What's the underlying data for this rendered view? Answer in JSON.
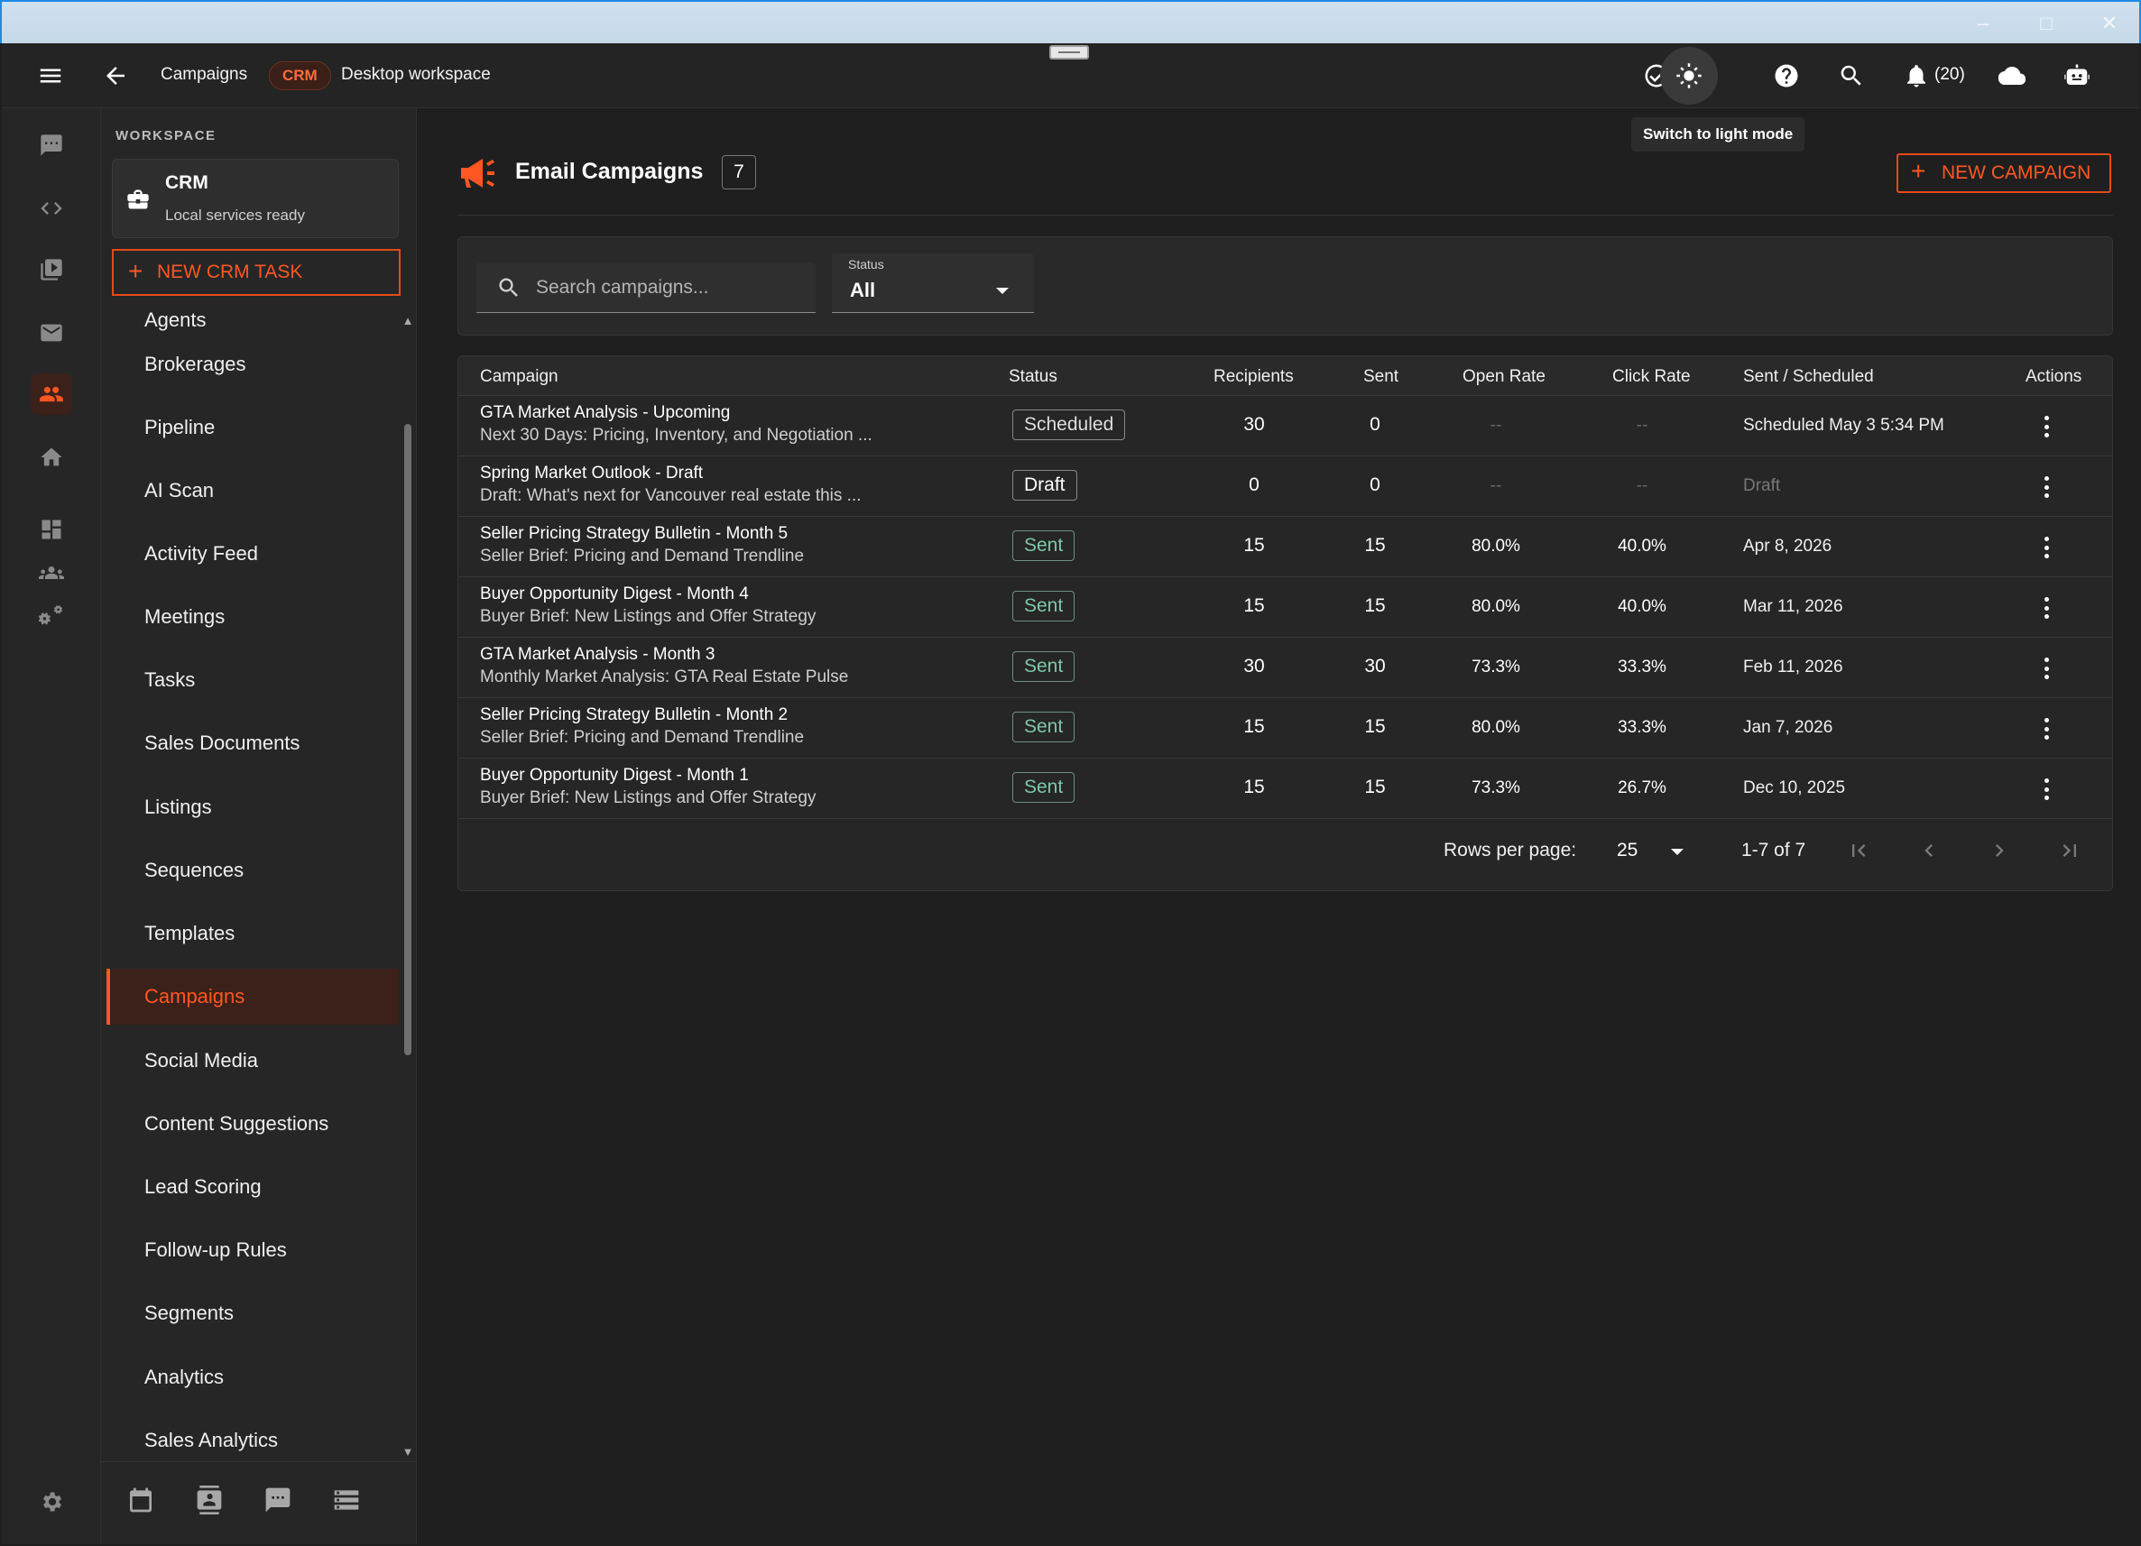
{
  "header": {
    "section_title": "Campaigns",
    "crm_badge": "CRM",
    "workspace_name": "Desktop workspace",
    "notification_count": "(20)",
    "theme_tooltip": "Switch to light mode"
  },
  "workspace": {
    "label": "WORKSPACE",
    "title": "CRM",
    "status": "Local services ready",
    "new_task_label": "NEW CRM TASK"
  },
  "nav": {
    "items": [
      {
        "label": "Agents"
      },
      {
        "label": "Brokerages"
      },
      {
        "label": "Pipeline"
      },
      {
        "label": "AI Scan"
      },
      {
        "label": "Activity Feed"
      },
      {
        "label": "Meetings"
      },
      {
        "label": "Tasks"
      },
      {
        "label": "Sales Documents"
      },
      {
        "label": "Listings"
      },
      {
        "label": "Sequences"
      },
      {
        "label": "Templates"
      },
      {
        "label": "Campaigns"
      },
      {
        "label": "Social Media"
      },
      {
        "label": "Content Suggestions"
      },
      {
        "label": "Lead Scoring"
      },
      {
        "label": "Follow-up Rules"
      },
      {
        "label": "Segments"
      },
      {
        "label": "Analytics"
      },
      {
        "label": "Sales Analytics"
      }
    ],
    "active": "Campaigns"
  },
  "page": {
    "title": "Email Campaigns",
    "count": "7",
    "new_button": "NEW CAMPAIGN"
  },
  "filters": {
    "search_placeholder": "Search campaigns...",
    "status_label": "Status",
    "status_value": "All"
  },
  "table": {
    "columns": [
      "Campaign",
      "Status",
      "Recipients",
      "Sent",
      "Open Rate",
      "Click Rate",
      "Sent / Scheduled",
      "Actions"
    ],
    "rows": [
      {
        "name": "GTA Market Analysis - Upcoming",
        "subject": "Next 30 Days: Pricing, Inventory, and Negotiation ...",
        "status": "Scheduled",
        "recipients": "30",
        "sent": "0",
        "open_rate": "--",
        "click_rate": "--",
        "date": "Scheduled May 3 5:34 PM"
      },
      {
        "name": "Spring Market Outlook - Draft",
        "subject": "Draft: What's next for Vancouver real estate this ...",
        "status": "Draft",
        "recipients": "0",
        "sent": "0",
        "open_rate": "--",
        "click_rate": "--",
        "date": "Draft"
      },
      {
        "name": "Seller Pricing Strategy Bulletin - Month 5",
        "subject": "Seller Brief: Pricing and Demand Trendline",
        "status": "Sent",
        "recipients": "15",
        "sent": "15",
        "open_rate": "80.0%",
        "click_rate": "40.0%",
        "date": "Apr 8, 2026"
      },
      {
        "name": "Buyer Opportunity Digest - Month 4",
        "subject": "Buyer Brief: New Listings and Offer Strategy",
        "status": "Sent",
        "recipients": "15",
        "sent": "15",
        "open_rate": "80.0%",
        "click_rate": "40.0%",
        "date": "Mar 11, 2026"
      },
      {
        "name": "GTA Market Analysis - Month 3",
        "subject": "Monthly Market Analysis: GTA Real Estate Pulse",
        "status": "Sent",
        "recipients": "30",
        "sent": "30",
        "open_rate": "73.3%",
        "click_rate": "33.3%",
        "date": "Feb 11, 2026"
      },
      {
        "name": "Seller Pricing Strategy Bulletin - Month 2",
        "subject": "Seller Brief: Pricing and Demand Trendline",
        "status": "Sent",
        "recipients": "15",
        "sent": "15",
        "open_rate": "80.0%",
        "click_rate": "33.3%",
        "date": "Jan 7, 2026"
      },
      {
        "name": "Buyer Opportunity Digest - Month 1",
        "subject": "Buyer Brief: New Listings and Offer Strategy",
        "status": "Sent",
        "recipients": "15",
        "sent": "15",
        "open_rate": "73.3%",
        "click_rate": "26.7%",
        "date": "Dec 10, 2025"
      }
    ]
  },
  "pagination": {
    "rows_per_page_label": "Rows per page:",
    "rows_per_page": "25",
    "range": "1-7 of 7"
  },
  "colors": {
    "accent": "#ff5722",
    "background": "#1f1f1f",
    "sent_status": "#7fc7a8"
  },
  "icons": {
    "rail": [
      "chat-icon",
      "code-icon",
      "media-icon",
      "mail-icon",
      "people-icon",
      "home-icon",
      "dashboard-icon",
      "groups-icon",
      "settings-gears-icon",
      "settings-icon"
    ],
    "header": [
      "menu-icon",
      "back-arrow-icon",
      "check-circle-icon",
      "sun-icon",
      "help-icon",
      "search-icon",
      "bell-icon",
      "cloud-icon",
      "robot-icon"
    ],
    "sidebar_bottom": [
      "calendar-icon",
      "contact-card-icon",
      "message-icon",
      "list-icon"
    ]
  }
}
